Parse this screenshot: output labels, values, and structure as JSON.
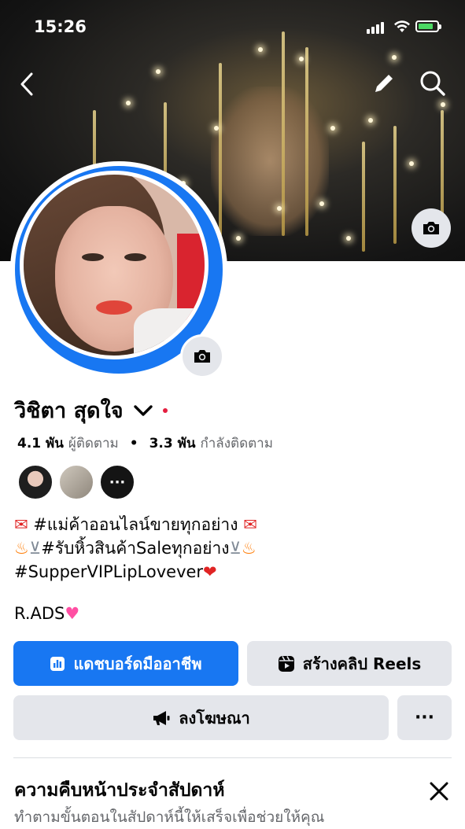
{
  "status_bar": {
    "time": "15:26"
  },
  "profile": {
    "name": "วิชิตา สุดใจ",
    "followers_count": "4.1 พัน",
    "followers_label": "ผู้ติดตาม",
    "following_count": "3.3 พัน",
    "following_label": "กำลังติดตาม",
    "more_friends": "···"
  },
  "bio": {
    "line1": "#แม่ค้าออนไลน์ขายทุกอย่าง",
    "line2": "#รับหิ้วสินค้าSaleทุกอย่าง",
    "line3": "#SupperVIPLipLovever",
    "line4": "R.ADS"
  },
  "buttons": {
    "dashboard": "แดชบอร์ดมืออาชีพ",
    "reels": "สร้างคลิป Reels",
    "ads": "ลงโฆษณา",
    "more": "···"
  },
  "progress": {
    "title": "ความคืบหน้าประจำสัปดาห์",
    "subtitle": "ทำตามขั้นตอนในสัปดาห์นี้ให้เสร็จเพื่อช่วยให้คุณ"
  },
  "colors": {
    "primary": "#1877f2",
    "secondary_button": "#e4e6eb",
    "text": "#050505",
    "muted": "#65676b"
  }
}
